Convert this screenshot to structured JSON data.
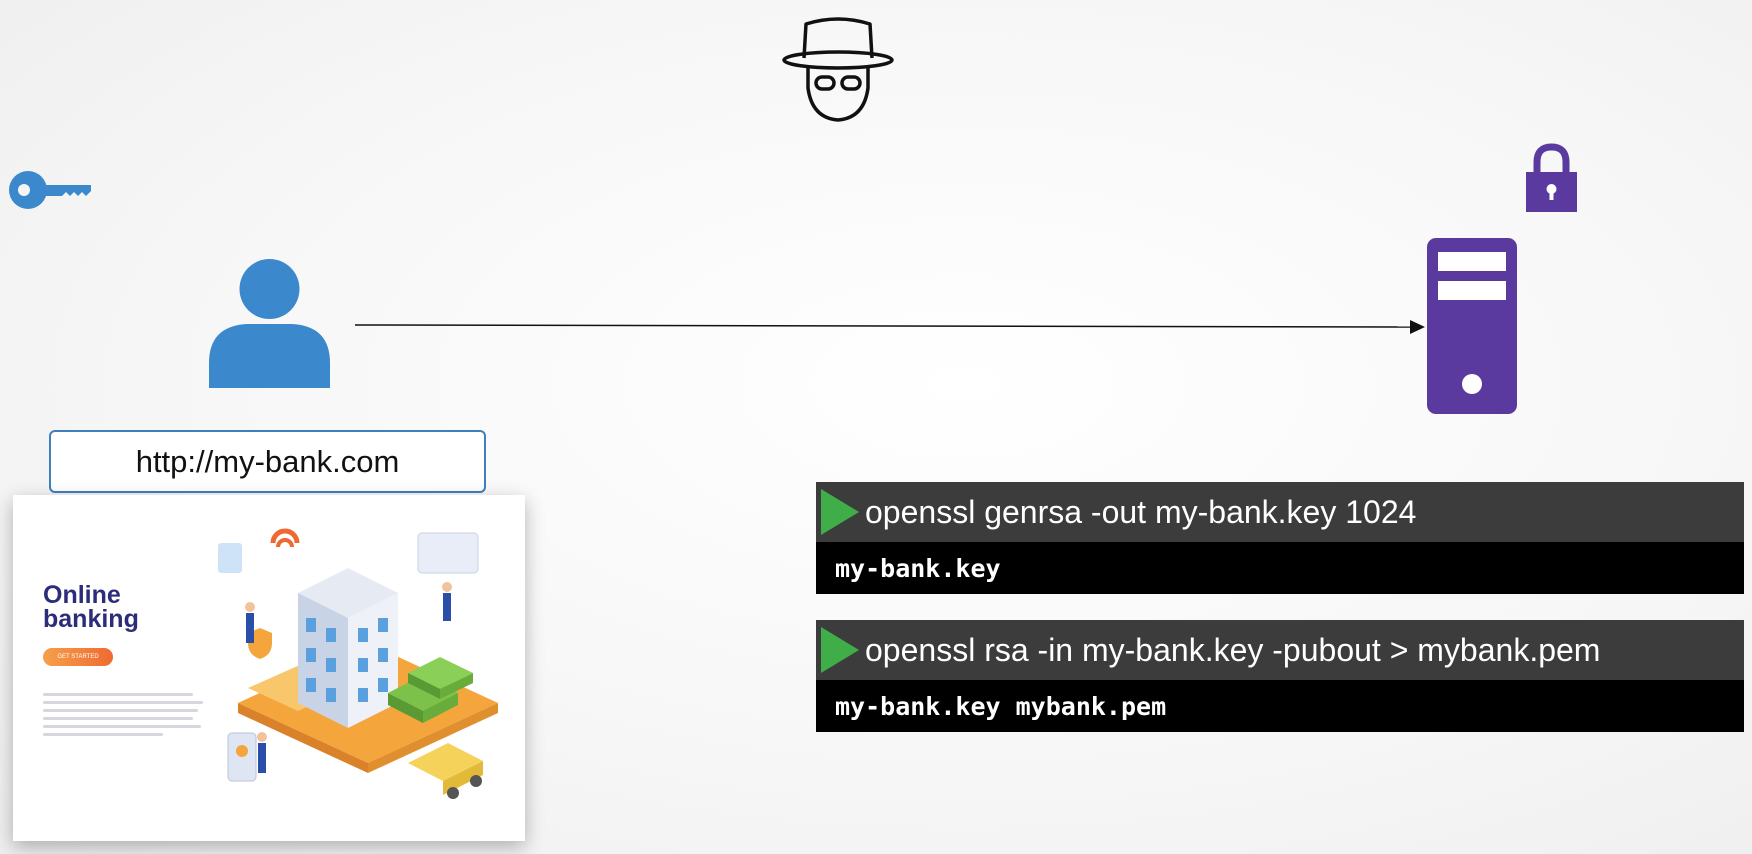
{
  "browser": {
    "url": "http://my-bank.com"
  },
  "website": {
    "title_line1": "Online",
    "title_line2": "banking",
    "button_label": "GET STARTED"
  },
  "terminals": [
    {
      "command": "openssl genrsa -out my-bank.key 1024",
      "output": "my-bank.key"
    },
    {
      "command": "openssl rsa -in my-bank.key -pubout > mybank.pem",
      "output": "my-bank.key mybank.pem"
    }
  ],
  "icons": {
    "hacker": "hacker-icon",
    "key": "key-icon",
    "lock": "lock-icon",
    "user": "user-icon",
    "server": "server-icon"
  },
  "colors": {
    "blue": "#3b88cc",
    "purple": "#5b3aa0",
    "green": "#3fae49",
    "terminal_header": "#3c3c3c",
    "terminal_body": "#000000"
  }
}
